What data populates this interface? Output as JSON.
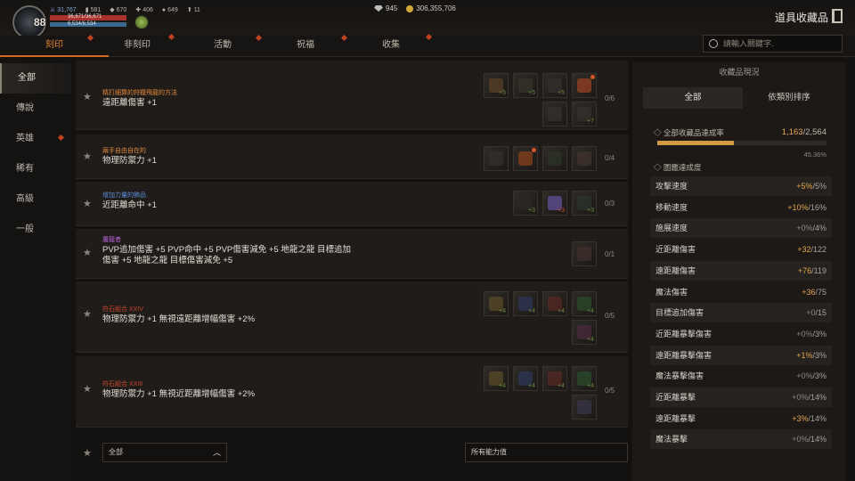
{
  "player": {
    "level": "88",
    "stats": [
      "31,767",
      "581",
      "670",
      "406",
      "649",
      "11"
    ],
    "hp": "36,671/36,671",
    "mp": "6,534/6,534"
  },
  "currency": {
    "diamonds": "945",
    "gold": "306,355,706"
  },
  "title": "道具收藏品",
  "tabs": [
    "刻印",
    "非刻印",
    "活動",
    "祝福",
    "收集"
  ],
  "search": {
    "placeholder": "請輸入關鍵字."
  },
  "sidebar": [
    "全部",
    "傳說",
    "英雄",
    "稀有",
    "高級",
    "一般"
  ],
  "rows": [
    {
      "cat": "精打細算的狩獵飛龍的方法",
      "desc": [
        "遠距離傷害 +1"
      ],
      "count": "0/6",
      "color": "#e38a3a"
    },
    {
      "cat": "兩手自由自在的",
      "desc": [
        "物理防禦力 +1"
      ],
      "count": "0/4",
      "color": "#e38a3a"
    },
    {
      "cat": "增加力量的飾品",
      "desc": [
        "近距離命中 +1"
      ],
      "count": "0/3",
      "color": "#5a8fd8"
    },
    {
      "cat": "屠龍者",
      "desc": [
        "PVP追加傷害 +5 PVP命中 +5 PVP傷害減免 +5 地龍之龍 目標追加",
        "傷害 +5 地龍之龍 目標傷害減免 +5"
      ],
      "count": "0/1",
      "color": "#b765d8"
    },
    {
      "cat": "符石組合 XXIV",
      "desc": [
        "物理防禦力 +1 無視遠距離增幅傷害 +2%"
      ],
      "count": "0/5",
      "color": "#c8462d"
    },
    {
      "cat": "符石組合 XXIII",
      "desc": [
        "物理防禦力 +1 無視近距離增幅傷害 +2%"
      ],
      "count": "0/5",
      "color": "#c8462d"
    }
  ],
  "slot_bonus": "+5",
  "slot_bonus2": "+7",
  "slot_bonus3": "+3",
  "slot_bonus4": "+4",
  "filters": {
    "grade": "全部",
    "ability": "所有能力值"
  },
  "panel": {
    "title": "收藏品現況",
    "tabs": [
      "全部",
      "依類別排序"
    ],
    "progress_label": "◇ 全部收藏品達成率",
    "progress_cur": "1,163",
    "progress_total": "/2,564",
    "progress_fraction": 0.4536,
    "progress_pct": "45.36%",
    "sub_label": "◇ 圖鑑達成度",
    "stats": [
      {
        "name": "攻擊速度",
        "cur": "+5%",
        "max": "/5%",
        "active": true
      },
      {
        "name": "移動速度",
        "cur": "+10%",
        "max": "/16%",
        "active": true
      },
      {
        "name": "施展速度",
        "cur": "+0%",
        "max": "/4%",
        "active": false
      },
      {
        "name": "近距離傷害",
        "cur": "+32",
        "max": "/122",
        "active": true
      },
      {
        "name": "遠距離傷害",
        "cur": "+76",
        "max": "/119",
        "active": true
      },
      {
        "name": "魔法傷害",
        "cur": "+36",
        "max": "/75",
        "active": true
      },
      {
        "name": "目標追加傷害",
        "cur": "+0",
        "max": "/15",
        "active": false
      },
      {
        "name": "近距離暴擊傷害",
        "cur": "+0%",
        "max": "/3%",
        "active": false
      },
      {
        "name": "遠距離暴擊傷害",
        "cur": "+1%",
        "max": "/3%",
        "active": true
      },
      {
        "name": "魔法暴擊傷害",
        "cur": "+0%",
        "max": "/3%",
        "active": false
      },
      {
        "name": "近距離暴擊",
        "cur": "+0%",
        "max": "/14%",
        "active": false
      },
      {
        "name": "遠距離暴擊",
        "cur": "+3%",
        "max": "/14%",
        "active": true
      },
      {
        "name": "魔法暴擊",
        "cur": "+0%",
        "max": "/14%",
        "active": false
      }
    ]
  }
}
